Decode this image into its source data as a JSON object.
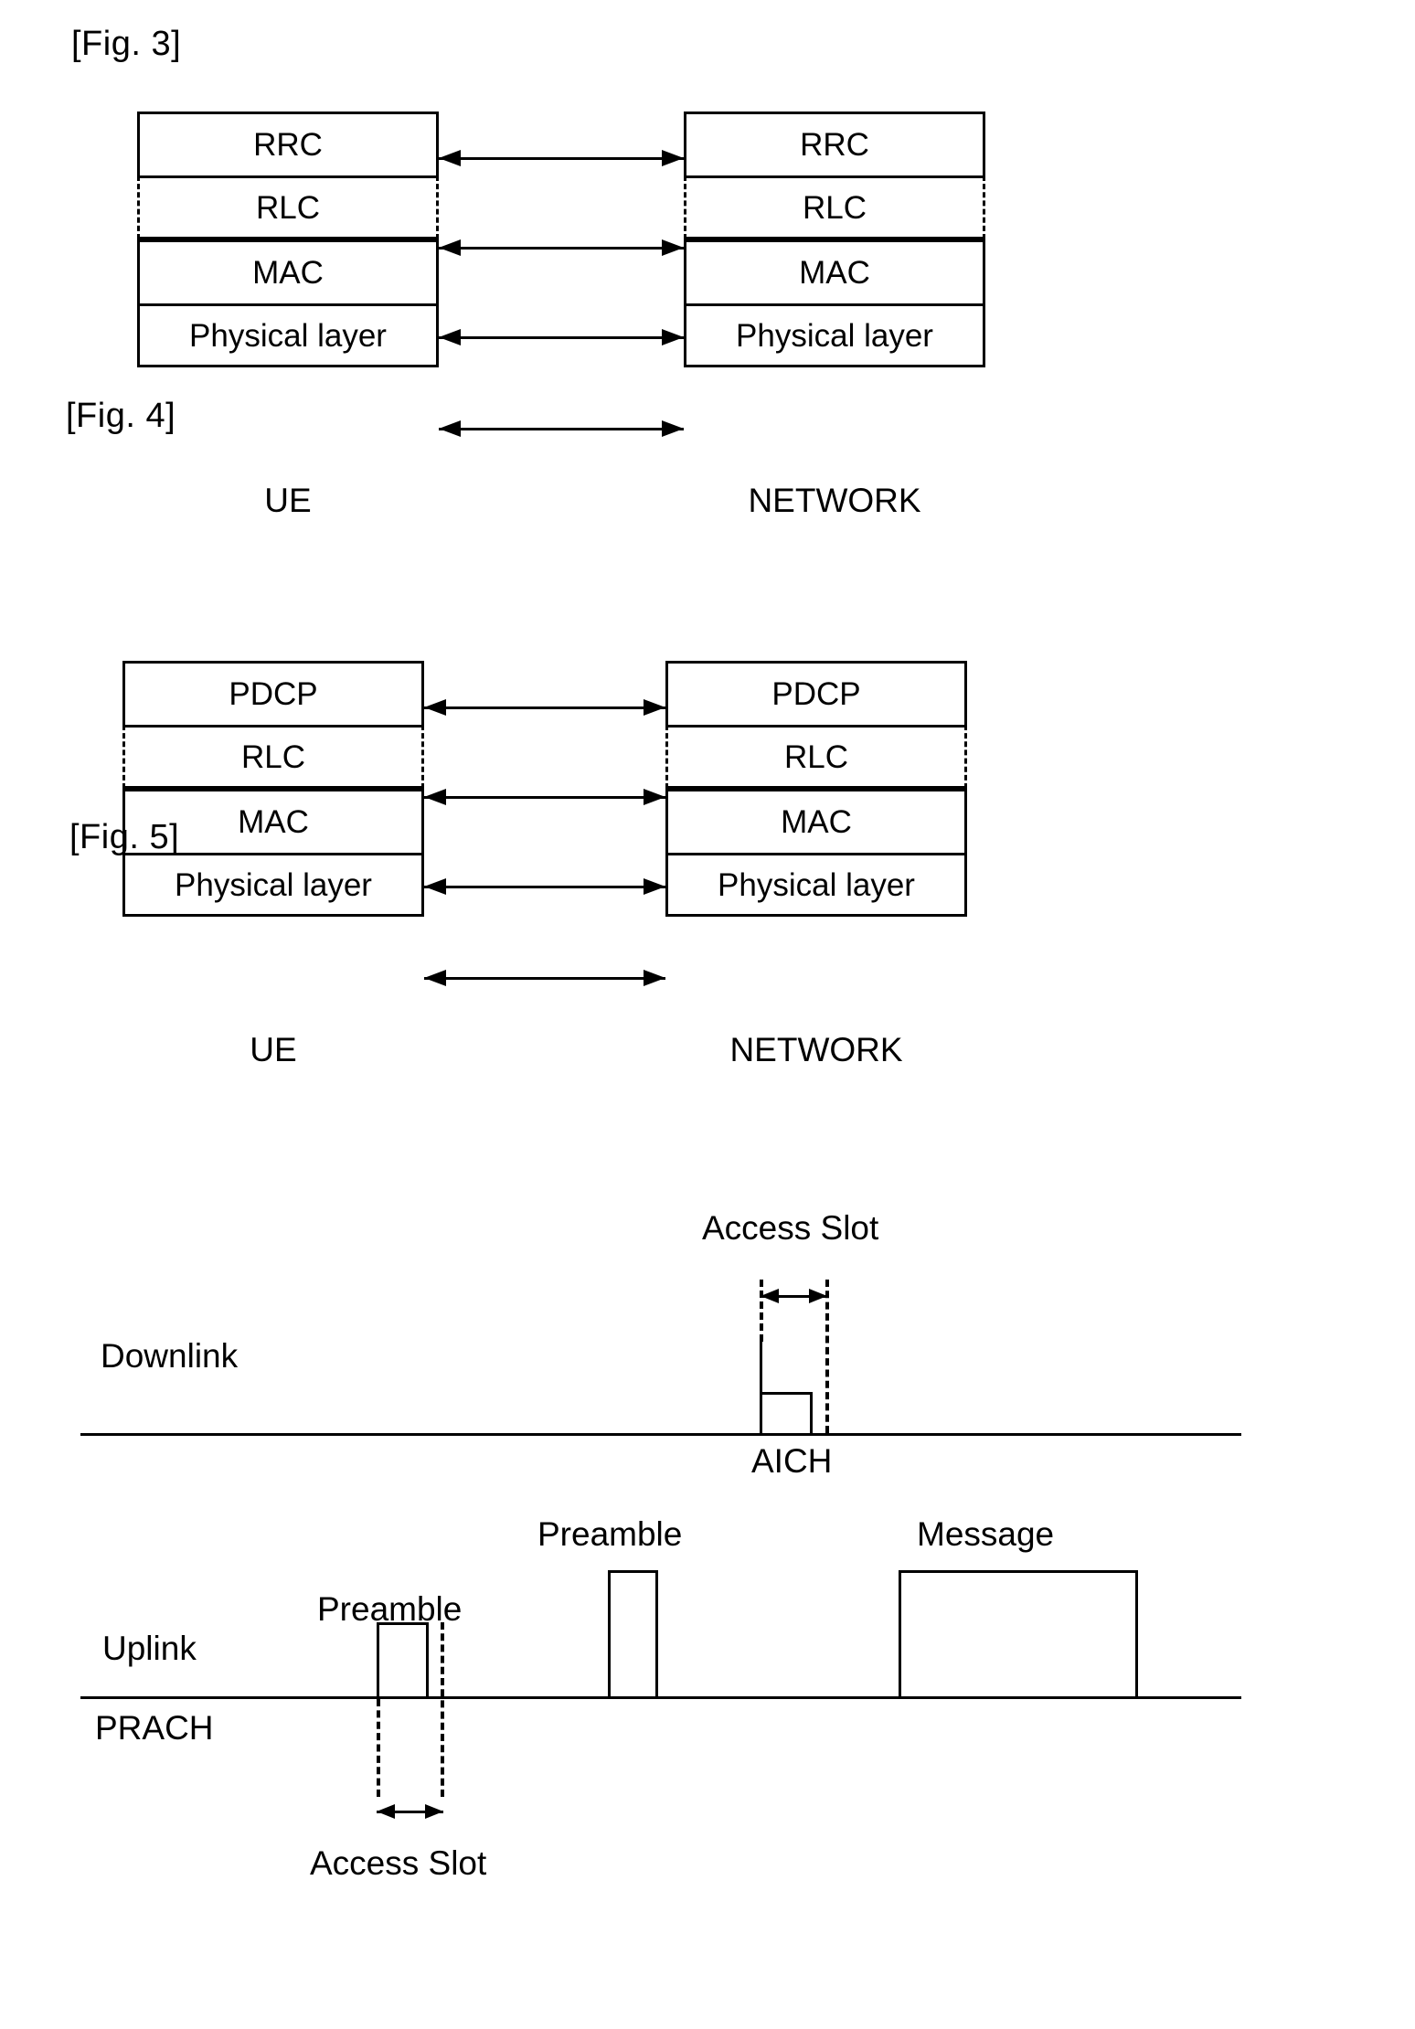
{
  "figures": {
    "fig3": {
      "caption": "[Fig. 3]",
      "left_stack": {
        "rows": [
          "RRC",
          "RLC",
          "MAC",
          "Physical layer"
        ],
        "caption": "UE"
      },
      "right_stack": {
        "rows": [
          "RRC",
          "RLC",
          "MAC",
          "Physical layer"
        ],
        "caption": "NETWORK"
      }
    },
    "fig4": {
      "caption": "[Fig. 4]",
      "left_stack": {
        "rows": [
          "PDCP",
          "RLC",
          "MAC",
          "Physical layer"
        ],
        "caption": "UE"
      },
      "right_stack": {
        "rows": [
          "PDCP",
          "RLC",
          "MAC",
          "Physical layer"
        ],
        "caption": "NETWORK"
      }
    },
    "fig5": {
      "caption": "[Fig. 5]",
      "downlink": {
        "axis_label": "Downlink",
        "access_slot_label": "Access Slot",
        "channel_label": "AICH"
      },
      "uplink": {
        "axis_label": "Uplink",
        "channel_label": "PRACH",
        "access_slot_label": "Access Slot",
        "burst_labels": {
          "preamble_1": "Preamble",
          "preamble_2": "Preamble",
          "message": "Message"
        }
      }
    }
  },
  "colors": {
    "ink": "#000000",
    "paper": "#ffffff"
  }
}
